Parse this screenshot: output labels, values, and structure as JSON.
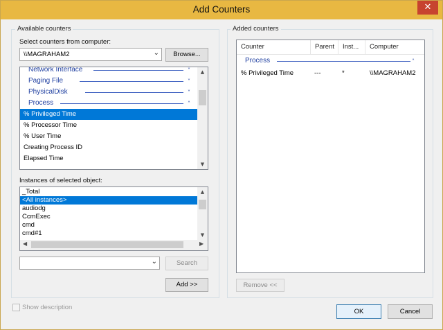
{
  "window": {
    "title": "Add Counters",
    "close_icon": "✕"
  },
  "available": {
    "group_label": "Available counters",
    "select_label": "Select counters from computer:",
    "computer_value": "\\\\MAGRAHAM2",
    "browse_label": "Browse...",
    "counter_items": [
      {
        "label": "Network Interface",
        "type": "group",
        "chevron": "˅"
      },
      {
        "label": "Paging File",
        "type": "group",
        "chevron": "˅"
      },
      {
        "label": "PhysicalDisk",
        "type": "group",
        "chevron": "˅"
      },
      {
        "label": "Process",
        "type": "group",
        "chevron": "˄"
      },
      {
        "label": "% Privileged Time",
        "type": "item",
        "selected": true
      },
      {
        "label": "% Processor Time",
        "type": "item"
      },
      {
        "label": "% User Time",
        "type": "item"
      },
      {
        "label": "Creating Process ID",
        "type": "item"
      },
      {
        "label": "Elapsed Time",
        "type": "item"
      }
    ],
    "instances_label": "Instances of selected object:",
    "instances": [
      {
        "label": "_Total"
      },
      {
        "label": "<All instances>",
        "selected": true
      },
      {
        "label": "audiodg"
      },
      {
        "label": "CcmExec"
      },
      {
        "label": "cmd"
      },
      {
        "label": "cmd#1"
      }
    ],
    "search_value": "",
    "search_label": "Search",
    "add_label": "Add >>"
  },
  "added": {
    "group_label": "Added counters",
    "columns": [
      "Counter",
      "Parent",
      "Inst...",
      "Computer"
    ],
    "group_name": "Process",
    "group_chevron": "˄",
    "rows": [
      {
        "counter": "% Privileged Time",
        "parent": "---",
        "instance": "*",
        "computer": "\\\\MAGRAHAM2"
      }
    ],
    "remove_label": "Remove <<"
  },
  "show_description_label": "Show description",
  "ok_label": "OK",
  "cancel_label": "Cancel",
  "colors": {
    "titlebar": "#e8b842",
    "selection": "#0078d7",
    "group_text": "#1f3fa0",
    "close": "#c7432f"
  }
}
